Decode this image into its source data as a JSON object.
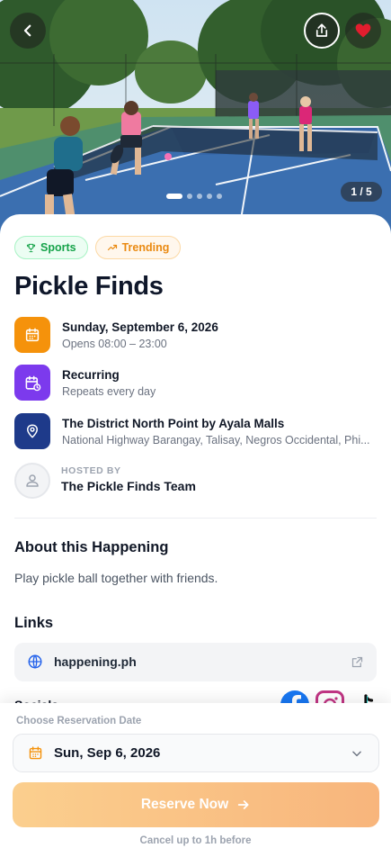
{
  "hero": {
    "image_description": "Pickleball players on outdoor court with trees",
    "counter": "1 / 5",
    "slide_count": 5,
    "active_slide": 1,
    "icons": {
      "back": "chevron-left-icon",
      "share": "share-icon",
      "favorite": "heart-icon"
    },
    "favorite_color": "#e11d2e"
  },
  "tags": [
    {
      "label": "Sports",
      "icon": "trophy-icon",
      "color": "#16a34a"
    },
    {
      "label": "Trending",
      "icon": "trending-up-icon",
      "color": "#ea8a12"
    }
  ],
  "event": {
    "title": "Pickle Finds",
    "date": {
      "main": "Sunday, September 6, 2026",
      "sub": "Opens 08:00 – 23:00",
      "icon": "calendar-icon",
      "color": "#f5920b"
    },
    "recurring": {
      "main": "Recurring",
      "sub": "Repeats every day",
      "icon": "calendar-repeat-icon",
      "color": "#7c3aed"
    },
    "location": {
      "main": "The District North Point by Ayala Malls",
      "sub": "National Highway Barangay, Talisay, Negros Occidental, Phi...",
      "icon": "location-pin-icon",
      "color": "#1e3a8a"
    },
    "host": {
      "label": "HOSTED BY",
      "name": "The Pickle Finds Team",
      "icon": "user-icon"
    }
  },
  "about": {
    "heading": "About this Happening",
    "text": "Play pickle ball together with friends."
  },
  "links": {
    "heading": "Links",
    "items": [
      {
        "label": "happening.ph",
        "icon": "globe-icon",
        "action_icon": "external-link-icon"
      }
    ]
  },
  "socials": {
    "label": "Socials",
    "items": [
      {
        "name": "facebook-icon"
      },
      {
        "name": "instagram-icon"
      },
      {
        "name": "tiktok-icon"
      }
    ]
  },
  "reservation": {
    "label": "Choose Reservation Date",
    "selected_date": "Sun, Sep 6, 2026",
    "button": "Reserve Now",
    "note": "Cancel up to 1h before"
  }
}
